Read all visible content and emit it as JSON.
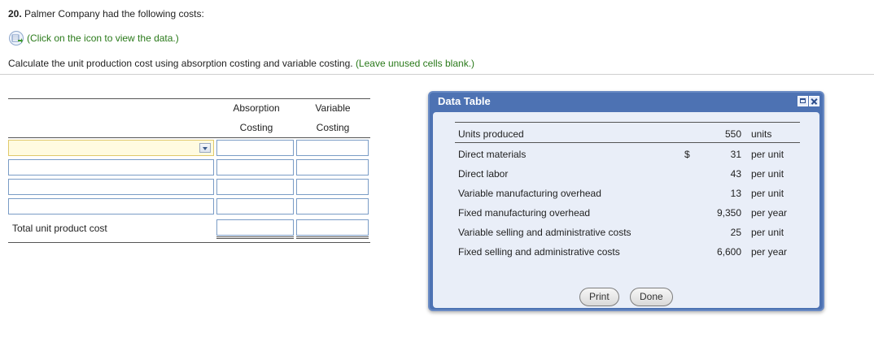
{
  "question": {
    "number": "20.",
    "text": "Palmer Company had the following costs:",
    "data_link": "(Click on the icon to view the data.)",
    "instruction": "Calculate the unit production cost using absorption costing and variable costing.",
    "hint": "(Leave unused cells blank.)"
  },
  "answer_table": {
    "col1_line1": "Absorption",
    "col1_line2": "Costing",
    "col2_line1": "Variable",
    "col2_line2": "Costing",
    "total_label": "Total unit product cost"
  },
  "data_table": {
    "title": "Data Table",
    "currency_symbol": "$",
    "rows": [
      {
        "label": "Units produced",
        "value": "550",
        "unit": "units"
      },
      {
        "label": "Direct materials",
        "value": "31",
        "unit": "per unit"
      },
      {
        "label": "Direct labor",
        "value": "43",
        "unit": "per unit"
      },
      {
        "label": "Variable manufacturing overhead",
        "value": "13",
        "unit": "per unit"
      },
      {
        "label": "Fixed manufacturing overhead",
        "value": "9,350",
        "unit": "per year"
      },
      {
        "label": "Variable selling and administrative costs",
        "value": "25",
        "unit": "per unit"
      },
      {
        "label": "Fixed selling and administrative costs",
        "value": "6,600",
        "unit": "per year"
      }
    ],
    "print_label": "Print",
    "done_label": "Done"
  },
  "colors": {
    "link_green": "#2a7a1a",
    "window_blue": "#4d72b3",
    "input_border": "#7a9cc6"
  },
  "icons": {
    "data_icon": "spreadsheet-arrow-icon"
  }
}
